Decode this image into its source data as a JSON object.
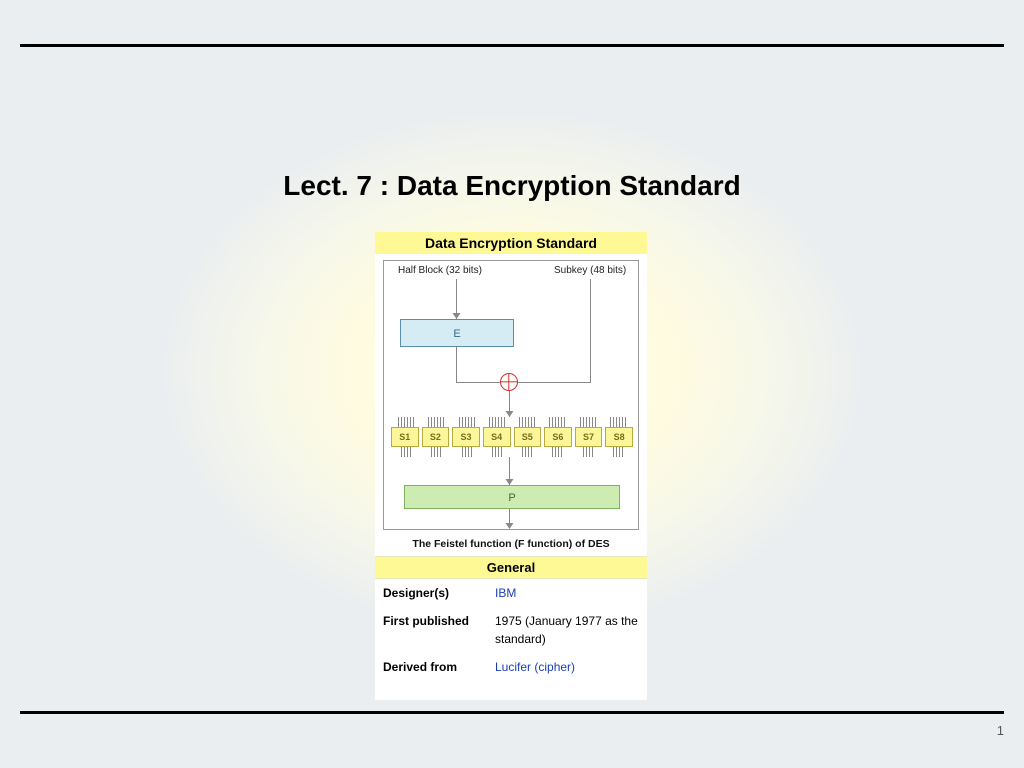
{
  "slide": {
    "title": "Lect. 7 :  Data Encryption Standard",
    "page_number": "1"
  },
  "infobox": {
    "title": "Data Encryption Standard",
    "diagram": {
      "half_block_label": "Half Block (32 bits)",
      "subkey_label": "Subkey (48 bits)",
      "e_label": "E",
      "p_label": "P",
      "sboxes": [
        "S1",
        "S2",
        "S3",
        "S4",
        "S5",
        "S6",
        "S7",
        "S8"
      ],
      "caption": "The Feistel function (F function) of DES"
    },
    "general_header": "General",
    "rows": [
      {
        "k": "Designer(s)",
        "v": "IBM",
        "link": true
      },
      {
        "k": "First published",
        "v": "1975 (January 1977 as the standard)",
        "link": false
      },
      {
        "k": "Derived from",
        "v": "Lucifer (cipher)",
        "link": true
      }
    ]
  }
}
